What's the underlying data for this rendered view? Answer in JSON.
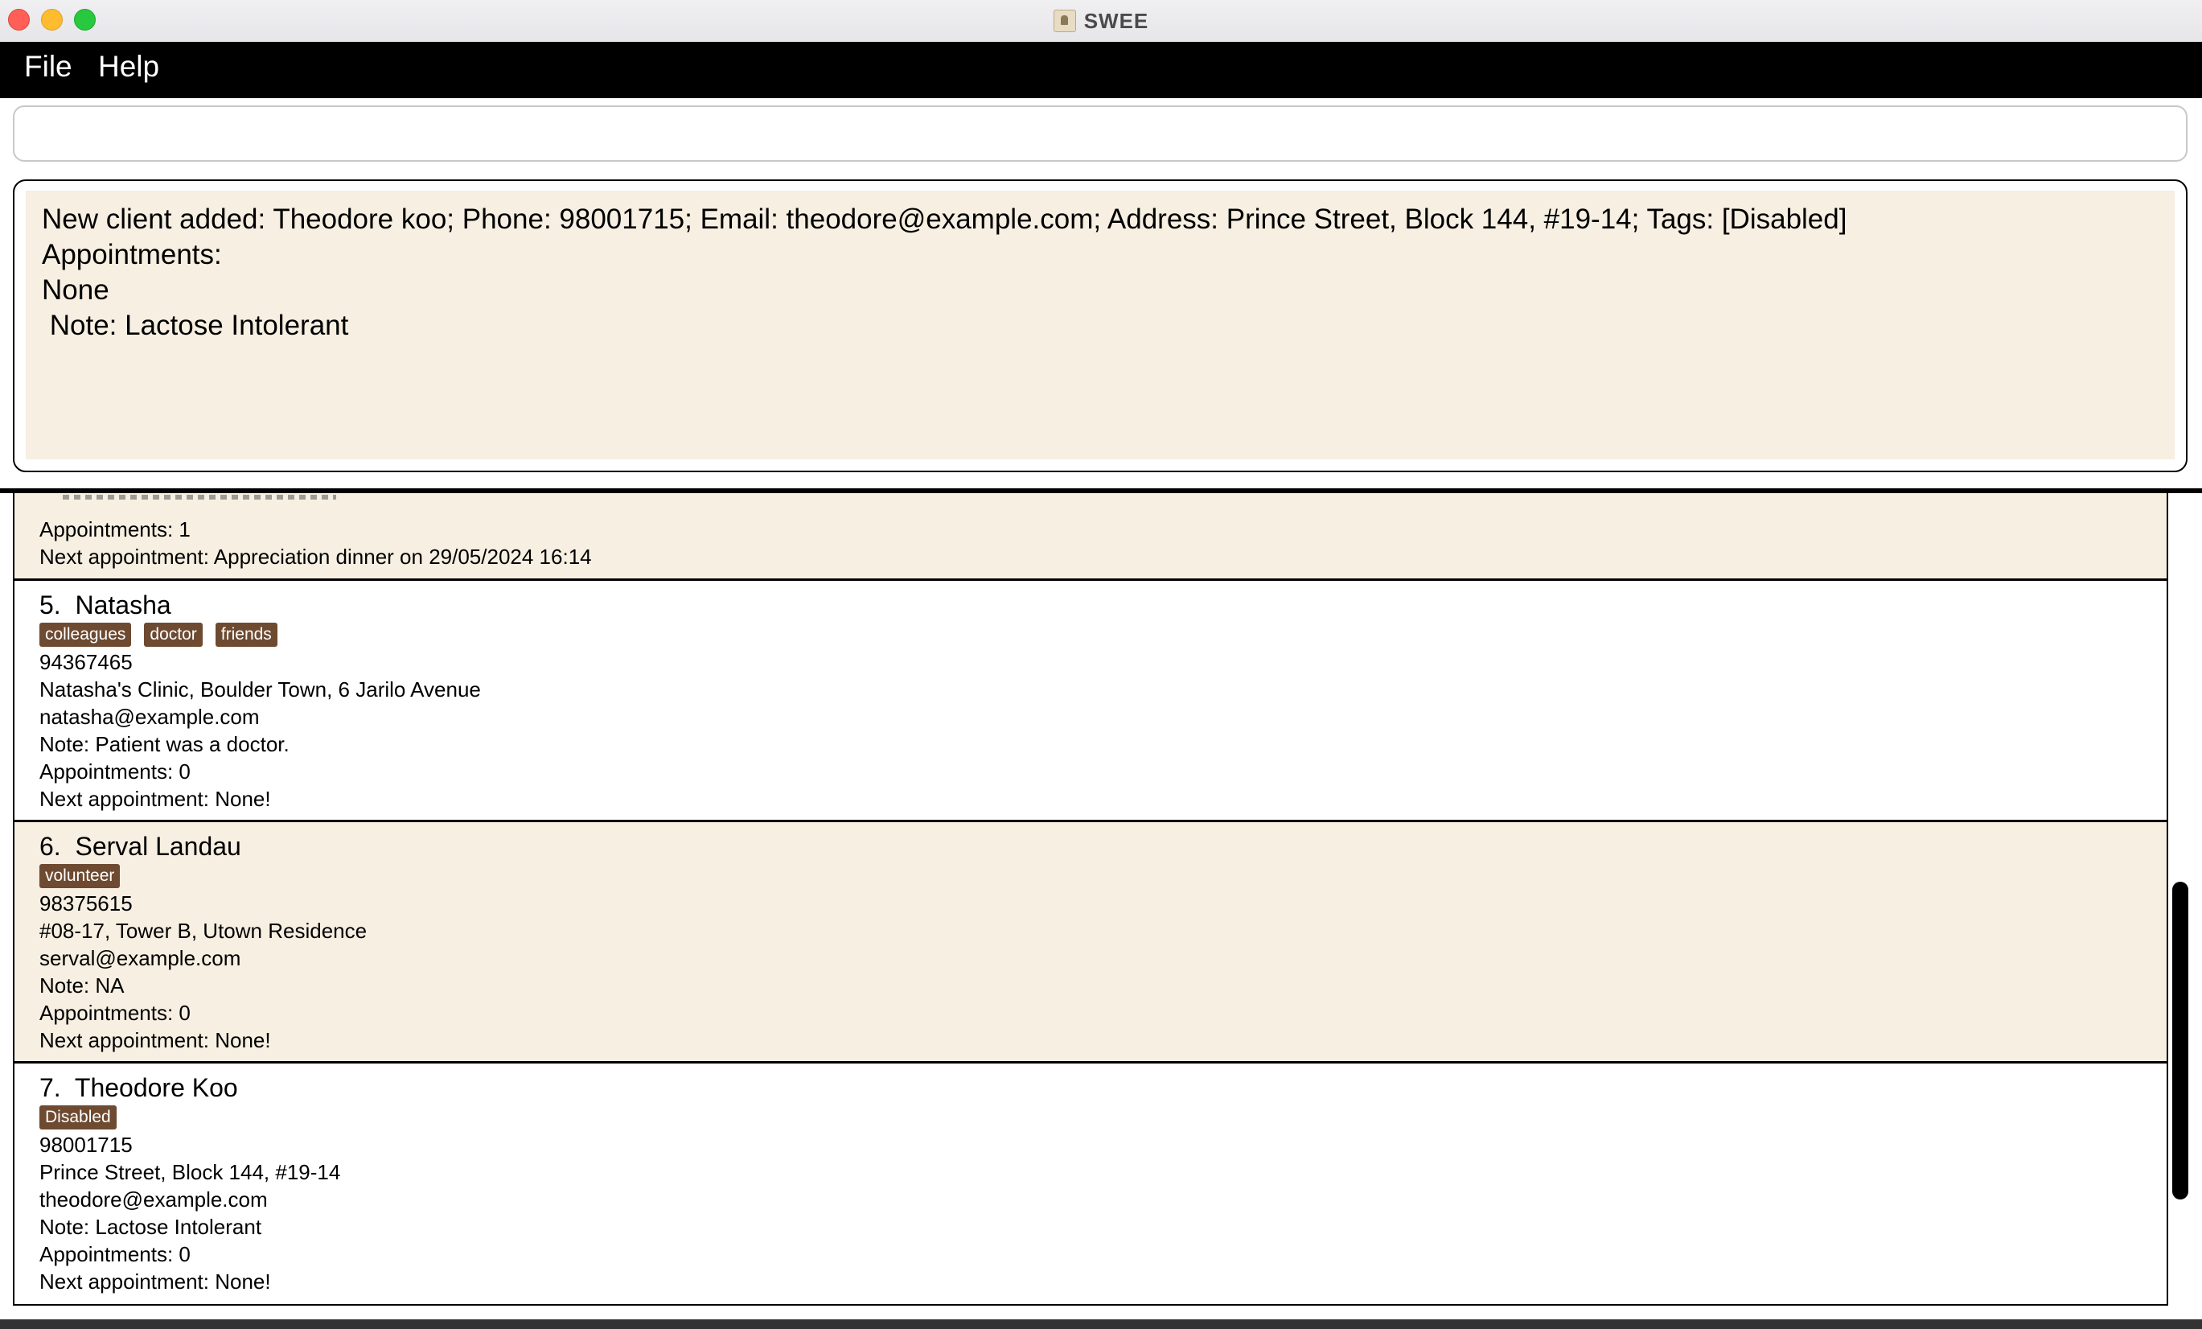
{
  "window": {
    "title": "SWEE"
  },
  "menu": {
    "file": "File",
    "help": "Help"
  },
  "command": {
    "value": "",
    "placeholder": ""
  },
  "result": {
    "lines": [
      "New client added: Theodore koo; Phone: 98001715; Email: theodore@example.com; Address: Prince Street, Block 144, #19-14; Tags: [Disabled]",
      "Appointments:",
      "None",
      " Note: Lactose Intolerant"
    ]
  },
  "clients": [
    {
      "appointments": "Appointments: 1",
      "next_appointment": "Next appointment: Appreciation dinner on 29/05/2024 16:14"
    },
    {
      "index_name": "5.  Natasha",
      "tags": [
        "colleagues",
        "doctor",
        "friends"
      ],
      "phone": "94367465",
      "address": "Natasha's Clinic, Boulder Town, 6 Jarilo Avenue",
      "email": "natasha@example.com",
      "note": "Note: Patient was a doctor.",
      "appointments": "Appointments: 0",
      "next_appointment": "Next appointment: None!"
    },
    {
      "index_name": "6.  Serval Landau",
      "tags": [
        "volunteer"
      ],
      "phone": "98375615",
      "address": "#08-17, Tower B, Utown Residence",
      "email": "serval@example.com",
      "note": "Note: NA",
      "appointments": "Appointments: 0",
      "next_appointment": "Next appointment: None!"
    },
    {
      "index_name": "7.  Theodore Koo",
      "tags": [
        "Disabled"
      ],
      "phone": "98001715",
      "address": "Prince Street, Block 144, #19-14",
      "email": "theodore@example.com",
      "note": "Note: Lactose Intolerant",
      "appointments": "Appointments: 0",
      "next_appointment": "Next appointment: None!"
    }
  ]
}
